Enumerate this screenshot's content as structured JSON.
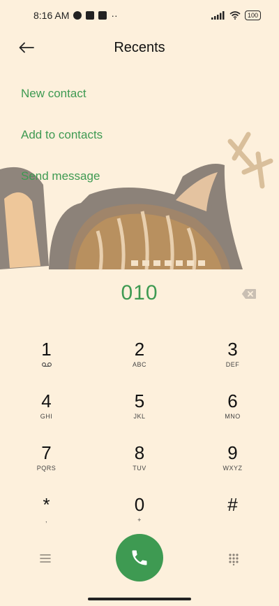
{
  "status": {
    "time": "8:16 AM",
    "more": "··",
    "battery": "100"
  },
  "app_bar": {
    "title": "Recents"
  },
  "actions": [
    {
      "label": "New contact"
    },
    {
      "label": "Add to contacts"
    },
    {
      "label": "Send message"
    }
  ],
  "dialer": {
    "number": "010",
    "keys": [
      {
        "digit": "1",
        "letters": ""
      },
      {
        "digit": "2",
        "letters": "ABC"
      },
      {
        "digit": "3",
        "letters": "DEF"
      },
      {
        "digit": "4",
        "letters": "GHI"
      },
      {
        "digit": "5",
        "letters": "JKL"
      },
      {
        "digit": "6",
        "letters": "MNO"
      },
      {
        "digit": "7",
        "letters": "PQRS"
      },
      {
        "digit": "8",
        "letters": "TUV"
      },
      {
        "digit": "9",
        "letters": "WXYZ"
      },
      {
        "digit": "*",
        "letters": ","
      },
      {
        "digit": "0",
        "letters": "+"
      },
      {
        "digit": "#",
        "letters": ""
      }
    ]
  },
  "colors": {
    "accent": "#3e9a52",
    "background": "#fdf0dc"
  }
}
